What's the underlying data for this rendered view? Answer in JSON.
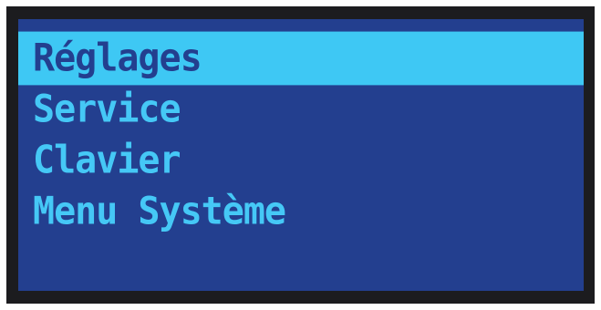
{
  "menu": {
    "items": [
      {
        "label": "Réglages",
        "selected": true
      },
      {
        "label": "Service",
        "selected": false
      },
      {
        "label": "Clavier",
        "selected": false
      },
      {
        "label": "Menu Système",
        "selected": false
      }
    ]
  },
  "colors": {
    "bezel": "#1c1c1f",
    "screen_background": "#233f8f",
    "text": "#45c8f6",
    "highlight": "#3ec8f4",
    "highlight_text": "#233f8f"
  }
}
